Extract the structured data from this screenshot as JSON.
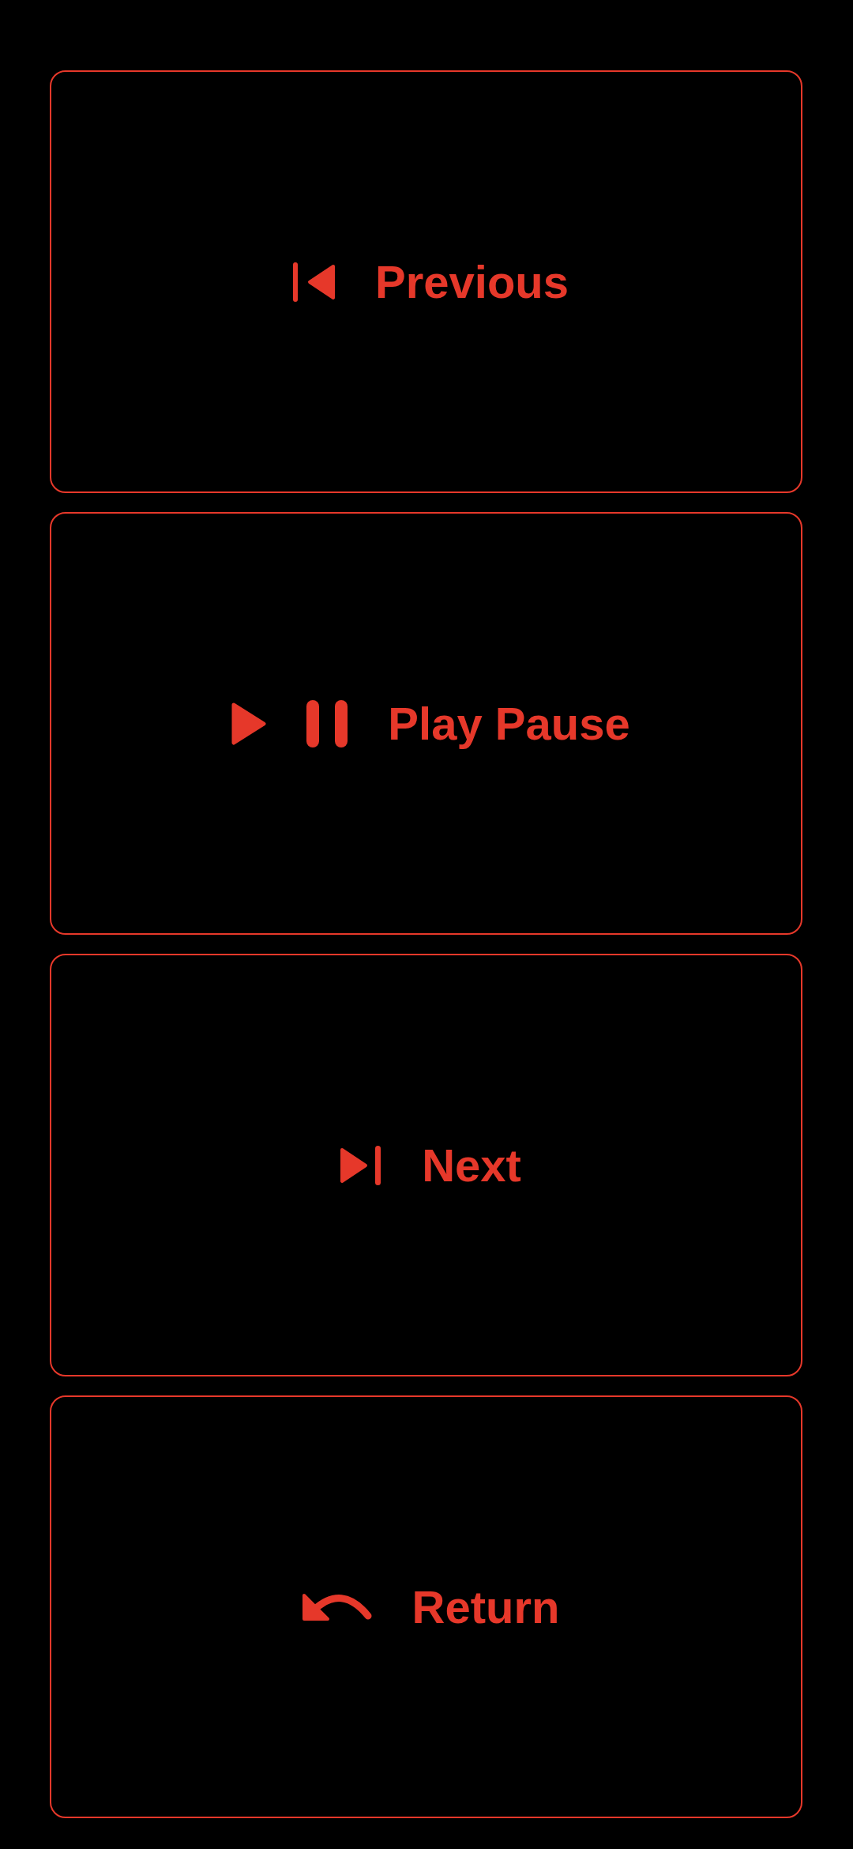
{
  "buttons": [
    {
      "kind": "previous",
      "label": "Previous"
    },
    {
      "kind": "play_pause",
      "label": "Play Pause"
    },
    {
      "kind": "next",
      "label": "Next"
    },
    {
      "kind": "return",
      "label": "Return"
    }
  ]
}
